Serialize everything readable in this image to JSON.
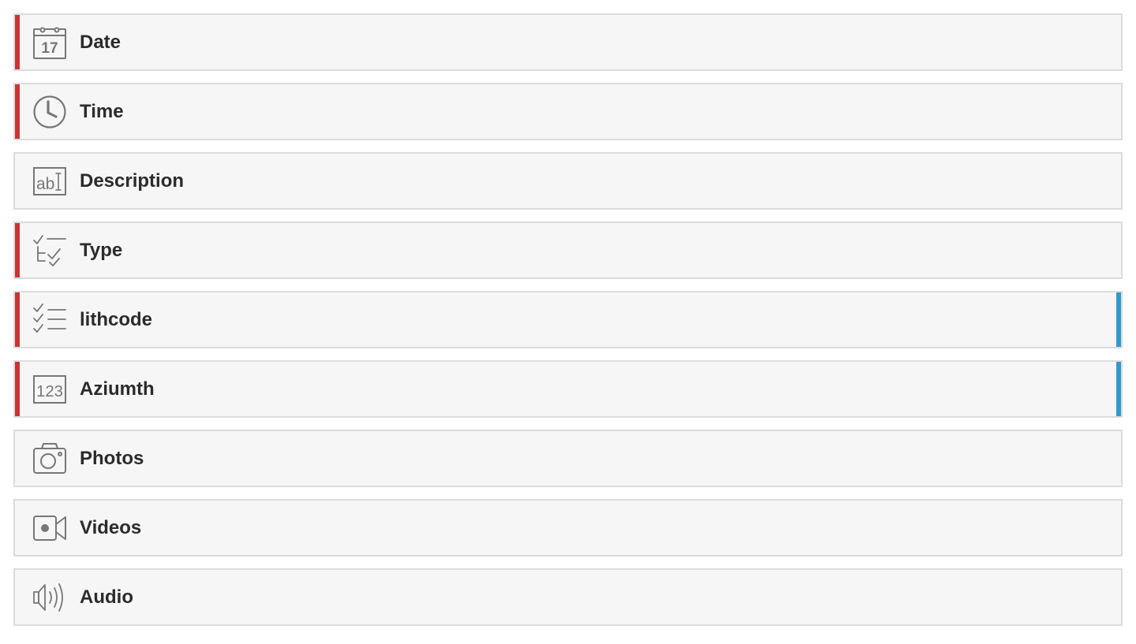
{
  "colors": {
    "required_marker": "#cc3333",
    "secondary_marker": "#3399cc",
    "row_background": "#f6f6f6",
    "row_border": "#dcdcdc",
    "icon_stroke": "#777777",
    "label_text": "#2b2b2b"
  },
  "fields": [
    {
      "label": "Date",
      "icon": "calendar-icon",
      "calendar_day": "17",
      "required": true,
      "secondary": false
    },
    {
      "label": "Time",
      "icon": "clock-icon",
      "required": true,
      "secondary": false
    },
    {
      "label": "Description",
      "icon": "text-field-icon",
      "icon_text": "ab",
      "required": false,
      "secondary": false
    },
    {
      "label": "Type",
      "icon": "single-choice-icon",
      "required": true,
      "secondary": false
    },
    {
      "label": "lithcode",
      "icon": "multi-choice-icon",
      "required": true,
      "secondary": true
    },
    {
      "label": "Aziumth",
      "icon": "number-icon",
      "icon_text": "123",
      "required": true,
      "secondary": true
    },
    {
      "label": "Photos",
      "icon": "camera-icon",
      "required": false,
      "secondary": false
    },
    {
      "label": "Videos",
      "icon": "video-camera-icon",
      "required": false,
      "secondary": false
    },
    {
      "label": "Audio",
      "icon": "speaker-icon",
      "required": false,
      "secondary": false
    }
  ]
}
